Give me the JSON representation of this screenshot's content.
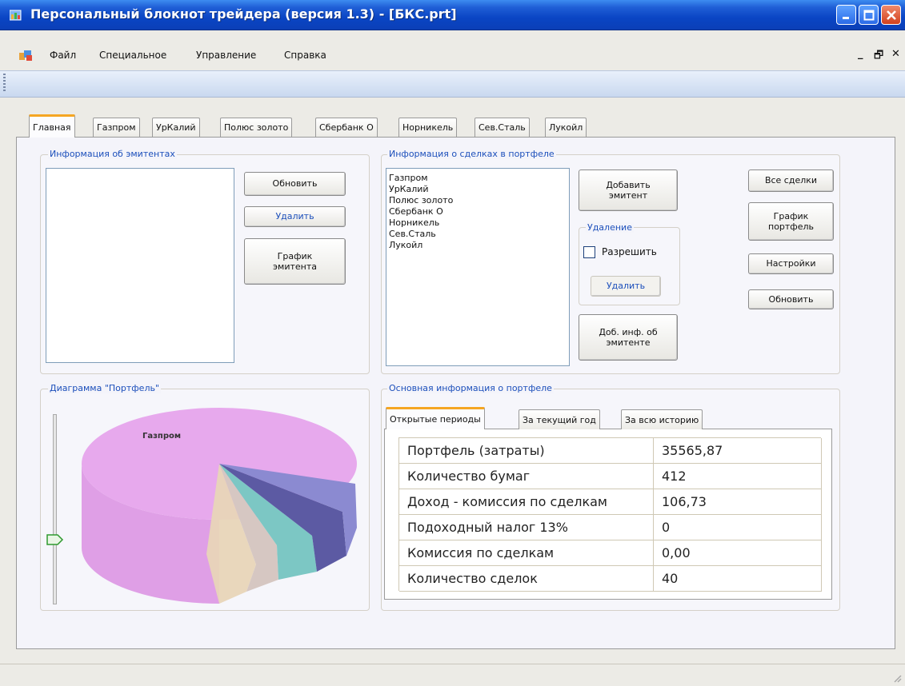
{
  "window": {
    "title": "Персональный блокнот трейдера (версия 1.3) - [БКС.prt]"
  },
  "menu": {
    "items": [
      "Файл",
      "Специальное",
      "Управление",
      "Справка"
    ],
    "mdi_controls": [
      "_",
      "🗗",
      "✕"
    ]
  },
  "main_tabs": [
    "Главная",
    "Газпром",
    "УрКалий",
    "Полюс золото",
    "Сбербанк О",
    "Норникель",
    "Сев.Сталь",
    "Лукойл"
  ],
  "emitters_group": {
    "label": "Информация об эмитентах",
    "buttons": {
      "refresh": "Обновить",
      "delete": "Удалить",
      "chart": "График эмитента"
    }
  },
  "deals_group": {
    "label": "Информация о сделках в портфеле",
    "list": [
      "Газпром",
      "УрКалий",
      "Полюс золото",
      "Сбербанк О",
      "Норникель",
      "Сев.Сталь",
      "Лукойл"
    ],
    "add_button": "Добавить эмитент",
    "delete_group": {
      "label": "Удаление",
      "checkbox_label": "Разрешить",
      "checkbox_checked": false,
      "delete_button": "Удалить"
    },
    "info_button": "Доб. инф. об эмитенте",
    "right_buttons": {
      "all_deals": "Все сделки",
      "portfolio_chart": "График портфель",
      "settings": "Настройки",
      "refresh": "Обновить"
    }
  },
  "diagram_group": {
    "label": "Диаграмма \"Портфель\"",
    "slice_label": "Газпром"
  },
  "summary_group": {
    "label": "Основная информация о портфеле",
    "tabs": [
      "Открытые периоды",
      "За текущий год",
      "За всю историю"
    ],
    "rows": [
      {
        "label": "Портфель (затраты)",
        "value": "35565,87"
      },
      {
        "label": "Количество бумаг",
        "value": "412"
      },
      {
        "label": "Доход - комиссия по сделкам",
        "value": "106,73"
      },
      {
        "label": "Подоходный налог 13%",
        "value": "0"
      },
      {
        "label": "Комиссия по сделкам",
        "value": "0,00"
      },
      {
        "label": "Количество сделок",
        "value": "40"
      }
    ]
  },
  "colors": {
    "titlebar": "#0a45c4",
    "accent_label": "#1c4fbb",
    "active_tab_top": "#f5a623"
  }
}
